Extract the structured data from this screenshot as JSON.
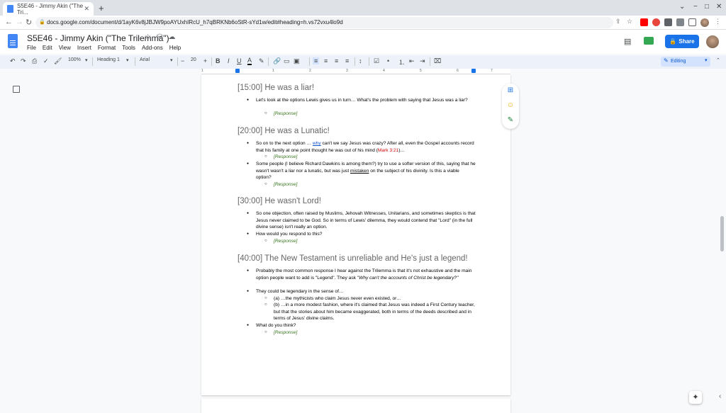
{
  "browser": {
    "tab_title": "S5E46 - Jimmy Akin (\"The Tri...",
    "tab_close": "✕",
    "new_tab": "+",
    "url": "docs.google.com/document/d/1ayK6v8jJBJW9poAYUxhIRcU_h7qBRKNb6oStR-sYd1w/edit#heading=h.vs72vxu4lo9d"
  },
  "docs": {
    "title": "S5E46 - Jimmy Akin (\"The Trilemma\")",
    "menu": [
      "File",
      "Edit",
      "View",
      "Insert",
      "Format",
      "Tools",
      "Add-ons",
      "Help"
    ],
    "share_label": "Share",
    "editing_label": "Editing"
  },
  "toolbar": {
    "zoom": "100%",
    "style": "Heading 1",
    "font": "Arial",
    "font_size": "20",
    "minus": "−",
    "plus": "+",
    "bold": "B",
    "italic": "I",
    "underline": "U",
    "text_color": "A"
  },
  "ruler": [
    "1",
    "1",
    "2",
    "3",
    "4",
    "5",
    "6",
    "7"
  ],
  "content": {
    "h1": "[15:00] He was a liar!",
    "h1_b1": "Let's look at the options Lewis gives us in turn…  What's the problem with saying that Jesus was a liar?",
    "response": "[Response]",
    "h2": "[20:00] He was a Lunatic!",
    "h2_b1_pre": "So on to the next option … ",
    "h2_b1_why": "why",
    "h2_b1_mid": " can't we say Jesus was crazy? After all, even the Gospel accounts record that his family at one point thought he was out of his mind (",
    "h2_b1_ref": "Mark 3:21",
    "h2_b1_post": ")…",
    "h2_b2_pre": "Some people (I believe Richard Dawkins is among them?) try to use a softer version of this, saying that he wasn't wasn't a liar nor a lunatic, but was just ",
    "h2_b2_mis": "mistaken",
    "h2_b2_post": " on the subject of his divinity. Is this a viable option?",
    "h3": "[30:00] He wasn't Lord!",
    "h3_b1": "So one objection, often raised by Muslims, Jehovah Witnesses, Unitarians, and sometimes skeptics is that Jesus never claimed to be God. So in terms of Lewis' dilemma, they would contend that \"Lord\" (in the full divine sense) isn't really an option.",
    "h3_b2": "How would you respond to this?",
    "h4": "[40:00] The New Testament is unreliable and He's just a legend!",
    "h4_b1_pre": "Probably the most common response I hear against the Trilemma is that it's not exhaustive and the main option people want to add is \"Legend\". They ask ",
    "h4_b1_it": "\"Why can't the accounts of Christ be legendary?\"",
    "h4_b2": "They could be legendary in the sense of…",
    "h4_s1": "(a) …the mythicists who claim Jesus never even existed, or…",
    "h4_s2": "(b) …in a more modest fashion, where it's claimed that Jesus was indeed a First Century teacher, but that the stories about him became exaggerated, both in terms of the deeds described and in terms of Jesus' divine claims.",
    "h4_b3": "What do you think?"
  }
}
